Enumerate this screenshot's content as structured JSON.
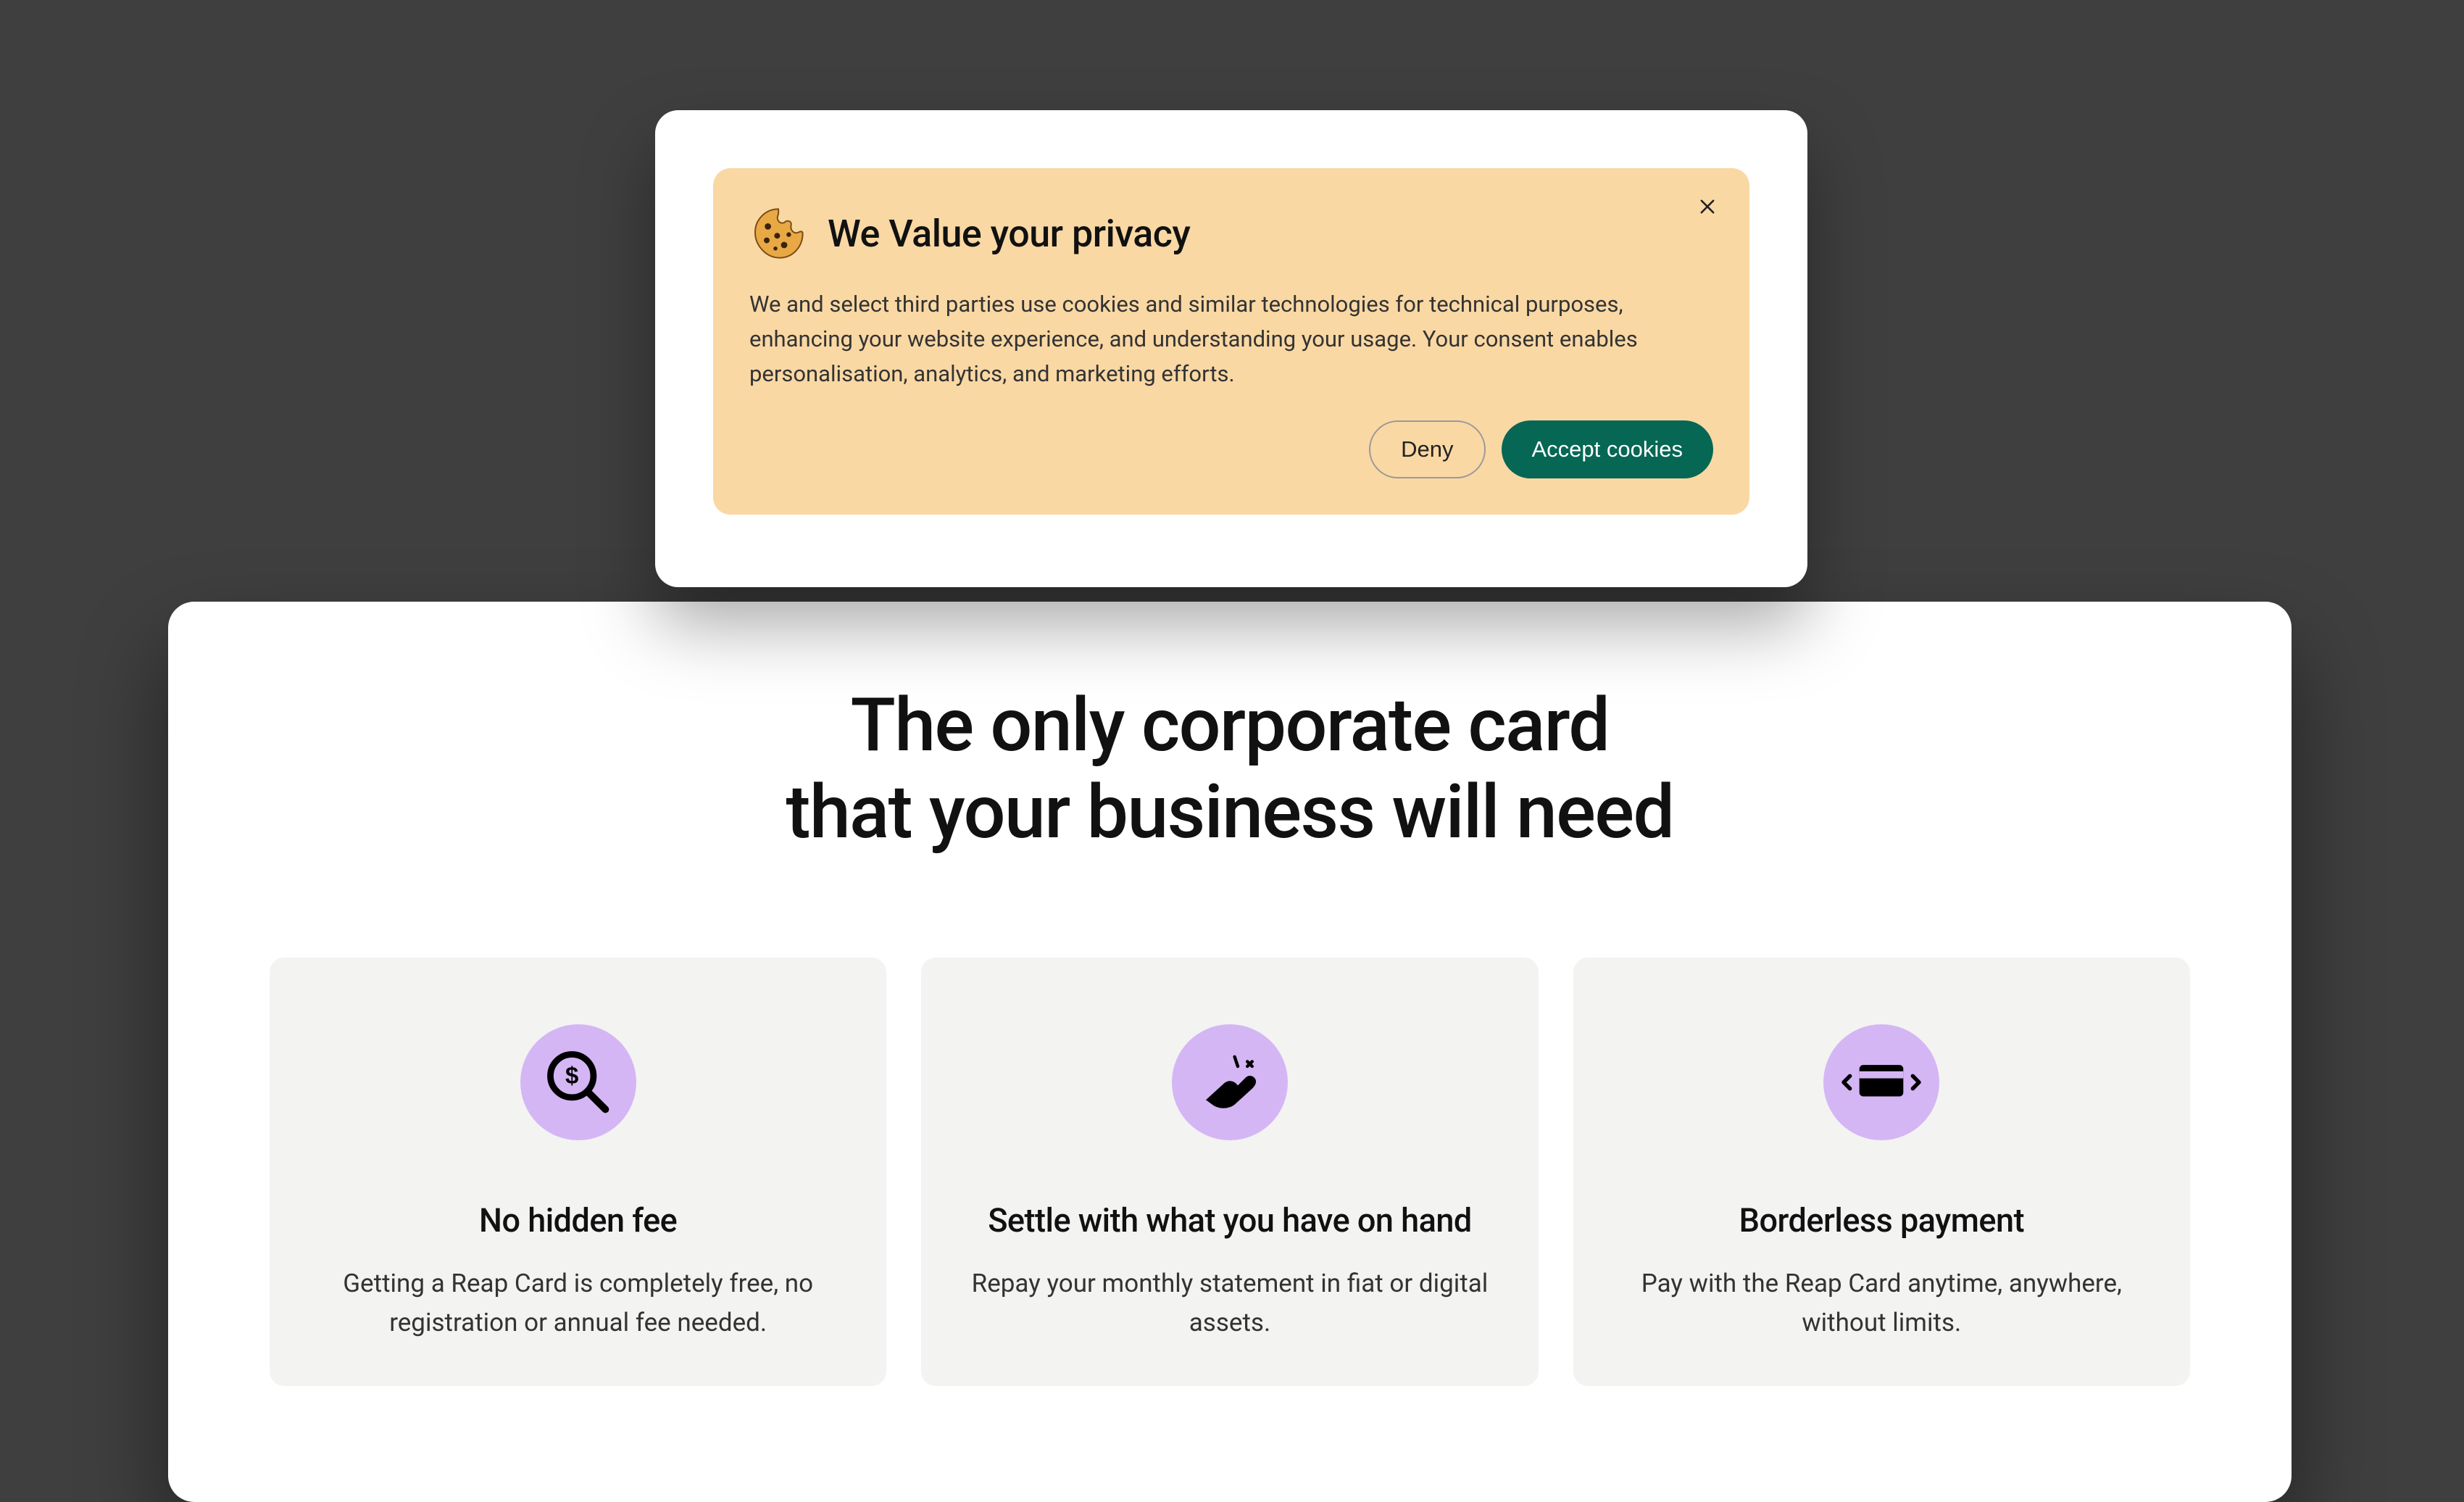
{
  "cookie": {
    "title": "We Value your privacy",
    "body": "We and select third parties use cookies and similar technologies for technical purposes, enhancing your website experience, and understanding your usage. Your consent enables personalisation, analytics, and marketing efforts.",
    "deny_label": "Deny",
    "accept_label": "Accept cookies"
  },
  "hero": {
    "line1": "The only corporate card",
    "line2": "that your business will need"
  },
  "features": [
    {
      "icon": "dollar-magnify-icon",
      "title": "No hidden fee",
      "desc": "Getting a Reap Card is completely free, no registration or annual fee needed."
    },
    {
      "icon": "snap-fingers-icon",
      "title": "Settle with what you have on hand",
      "desc": "Repay your monthly statement in fiat or digital assets."
    },
    {
      "icon": "card-arrows-icon",
      "title": "Borderless payment",
      "desc": "Pay with the Reap Card anytime, anywhere, without limits."
    }
  ],
  "colors": {
    "background": "#3f3f3f",
    "banner_bg": "#fad8a4",
    "accept_bg": "#056754",
    "icon_circle": "#d4b6f5",
    "feature_bg": "#f3f3f2"
  }
}
